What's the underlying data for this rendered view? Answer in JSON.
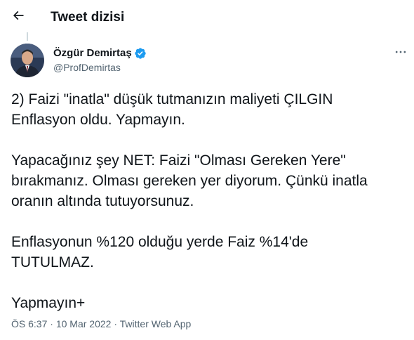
{
  "header": {
    "title": "Tweet dizisi",
    "back_icon": "arrow-left-icon"
  },
  "author": {
    "display_name": "Özgür Demirtaş",
    "handle": "@ProfDemirtas",
    "verified_icon": "verified-badge-icon",
    "verified_color": "#1d9bf0",
    "avatar_icon": "avatar-photo"
  },
  "more_icon": "more-horizontal-icon",
  "tweet": {
    "paragraphs": [
      [
        "2) Faizi \"inatla\" düşük tutmanızın maliyeti ÇILGIN",
        "Enflasyon oldu. Yapmayın."
      ],
      [
        "Yapacağınız şey NET: Faizi \"Olması Gereken Yere\"",
        "bırakmanız. Olması gereken yer diyorum. Çünkü inatla",
        "oranın altında tutuyorsunuz."
      ],
      [
        "Enflasyonun %120 olduğu yerde Faiz %14'de",
        "TUTULMAZ."
      ],
      [
        "Yapmayın+"
      ]
    ]
  },
  "meta": {
    "time": "ÖS 6:37",
    "separator_1": " · ",
    "date": "10 Mar 2022",
    "separator_2": " · ",
    "source": "Twitter Web App"
  },
  "colors": {
    "text_primary": "#0f1419",
    "text_secondary": "#536471",
    "thread_line": "#cfd9de",
    "accent": "#1d9bf0"
  }
}
